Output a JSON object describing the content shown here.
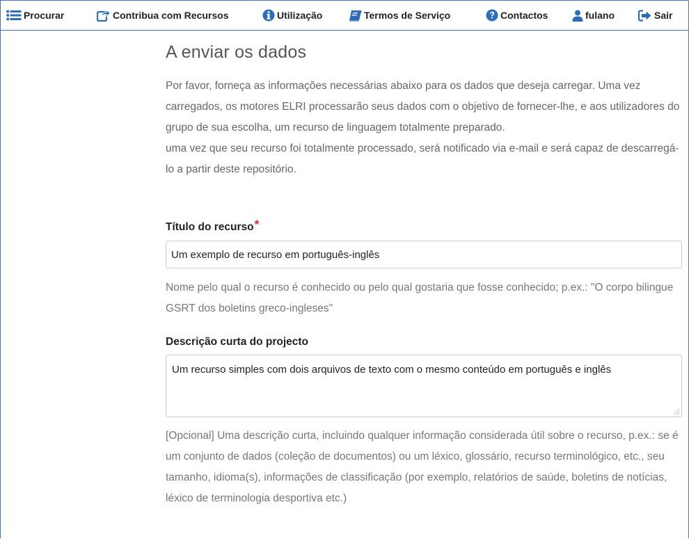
{
  "nav": {
    "items": [
      {
        "label": "Procurar",
        "icon": "list-icon"
      },
      {
        "label": "Contribua com Recursos",
        "icon": "share-icon"
      },
      {
        "label": "Utilização",
        "icon": "info-icon"
      },
      {
        "label": "Termos de Serviço",
        "icon": "book-icon"
      },
      {
        "label": "Contactos",
        "icon": "question-icon"
      },
      {
        "label": "fulano",
        "icon": "user-icon"
      },
      {
        "label": "Sair",
        "icon": "sign-out-icon"
      }
    ],
    "icon_color": "#2a6ebb"
  },
  "page": {
    "title": "A enviar os dados",
    "intro_1": "Por favor, forneça as informações necessárias abaixo para os dados que deseja carregar. Uma vez carregados, os motores ELRI processarão seus dados com o objetivo de fornecer-lhe, e aos utilizadores do grupo de sua escolha, um recurso de linguagem totalmente preparado.",
    "intro_2": "uma vez que seu recurso foi totalmente processado, será notificado via e-mail e será capaz de descarregá-lo a partir deste repositório."
  },
  "form": {
    "title_field": {
      "label": "Título do recurso",
      "required_mark": "*",
      "value": "Um exemplo de recurso em português-inglês",
      "help": "Nome pelo qual o recurso é conhecido ou pelo qual gostaria que fosse conhecido; p.ex.: \"O corpo bilingue GSRT dos boletins greco-ingleses\""
    },
    "description_field": {
      "label": "Descrição curta do projecto",
      "value": "Um recurso simples com dois arquivos de texto com o mesmo conteúdo em português e inglês",
      "help": "[Opcional] Uma descrição curta, incluindo qualquer informação considerada útil sobre o recurso, p.ex.: se é um conjunto de dados (coleção de documentos) ou um léxico, glossário, recurso terminológico, etc., seu tamanho, idioma(s), informações de classificação (por exemplo, relatórios de saúde, boletins de notícias, léxico de terminologia desportiva etc.)"
    }
  }
}
